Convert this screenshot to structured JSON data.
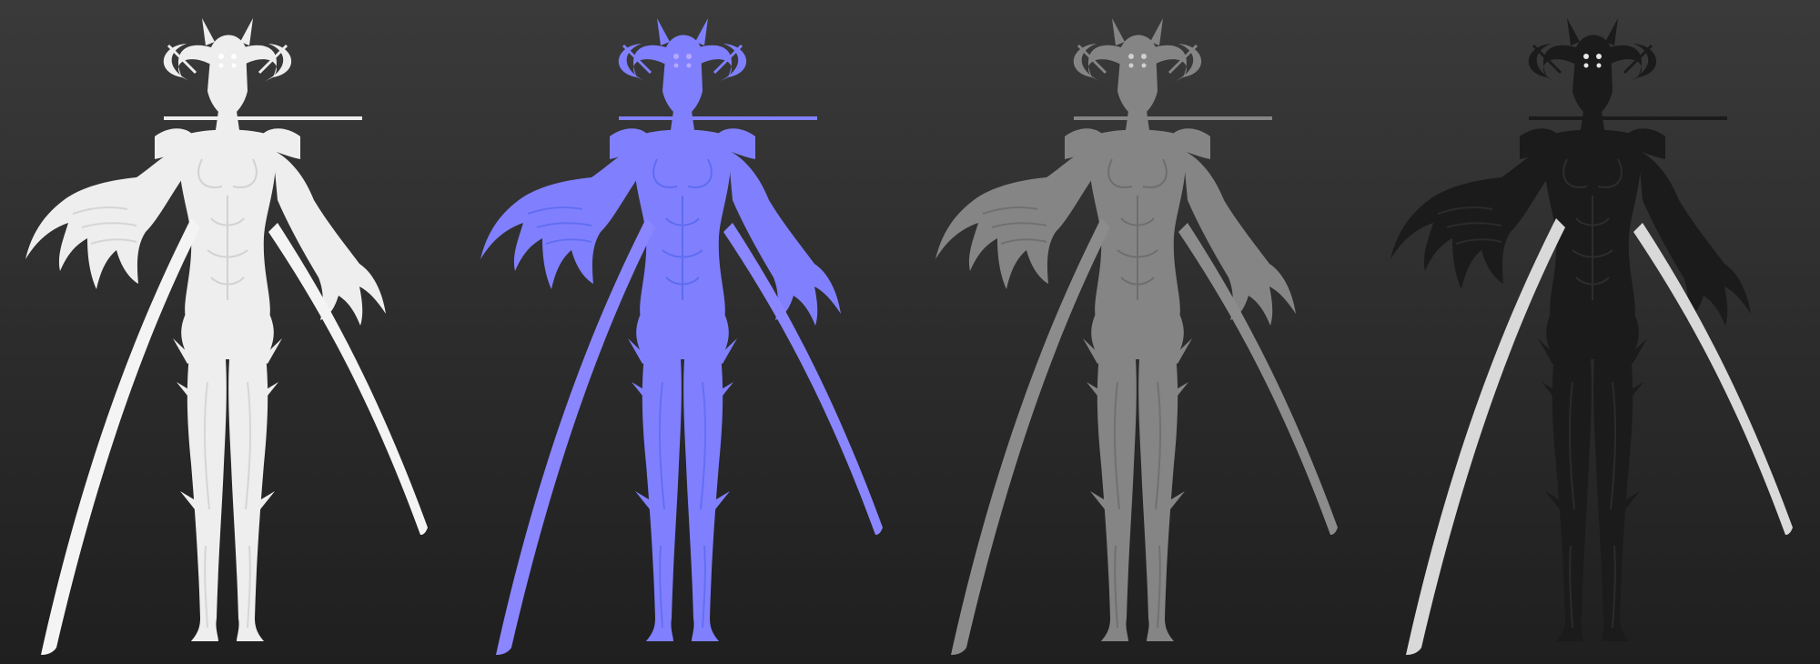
{
  "background": {
    "top": "#3a3a3a",
    "bottom": "#1f1f1f"
  },
  "renders": [
    {
      "id": "white-clay",
      "body": "#eeeeee",
      "detail": "#cfcfcf",
      "blade": "#f4f4f4",
      "eyes": "#ffffff"
    },
    {
      "id": "normal-map",
      "body": "#8080ff",
      "detail": "#5b6af0",
      "blade": "#8a86ff",
      "eyes": "#b6a8ff"
    },
    {
      "id": "grey-height",
      "body": "#858585",
      "detail": "#6c6c6c",
      "blade": "#8c8c8c",
      "eyes": "#cfcfcf"
    },
    {
      "id": "dark-roughness",
      "body": "#1b1b1b",
      "detail": "#2f2f2f",
      "blade": "#4a4a4a",
      "eyes": "#e8e8e8"
    }
  ]
}
